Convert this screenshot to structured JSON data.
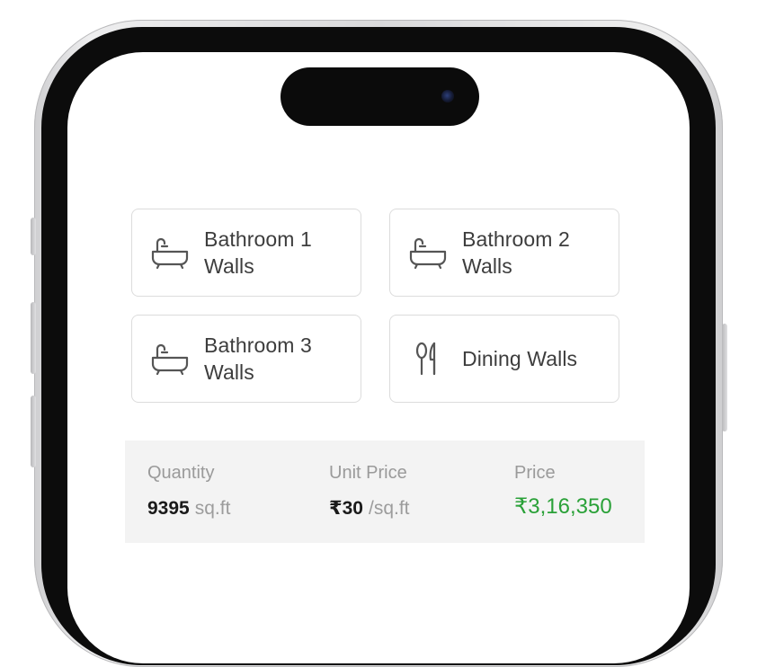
{
  "categories": [
    {
      "label": "Bathroom 1 Walls",
      "icon": "bathtub-icon"
    },
    {
      "label": "Bathroom 2 Walls",
      "icon": "bathtub-icon"
    },
    {
      "label": "Bathroom 3 Walls",
      "icon": "bathtub-icon"
    },
    {
      "label": "Dining Walls",
      "icon": "dining-icon"
    }
  ],
  "summary": {
    "quantity": {
      "label": "Quantity",
      "value": "9395",
      "unit": "sq.ft"
    },
    "unit_price": {
      "label": "Unit Price",
      "value": "₹30",
      "unit": "/sq.ft"
    },
    "price": {
      "label": "Price",
      "value": "₹3,16,350"
    }
  },
  "colors": {
    "price": "#2aa138",
    "card_border": "#dcdcdc",
    "summary_bg": "#f3f3f3"
  }
}
